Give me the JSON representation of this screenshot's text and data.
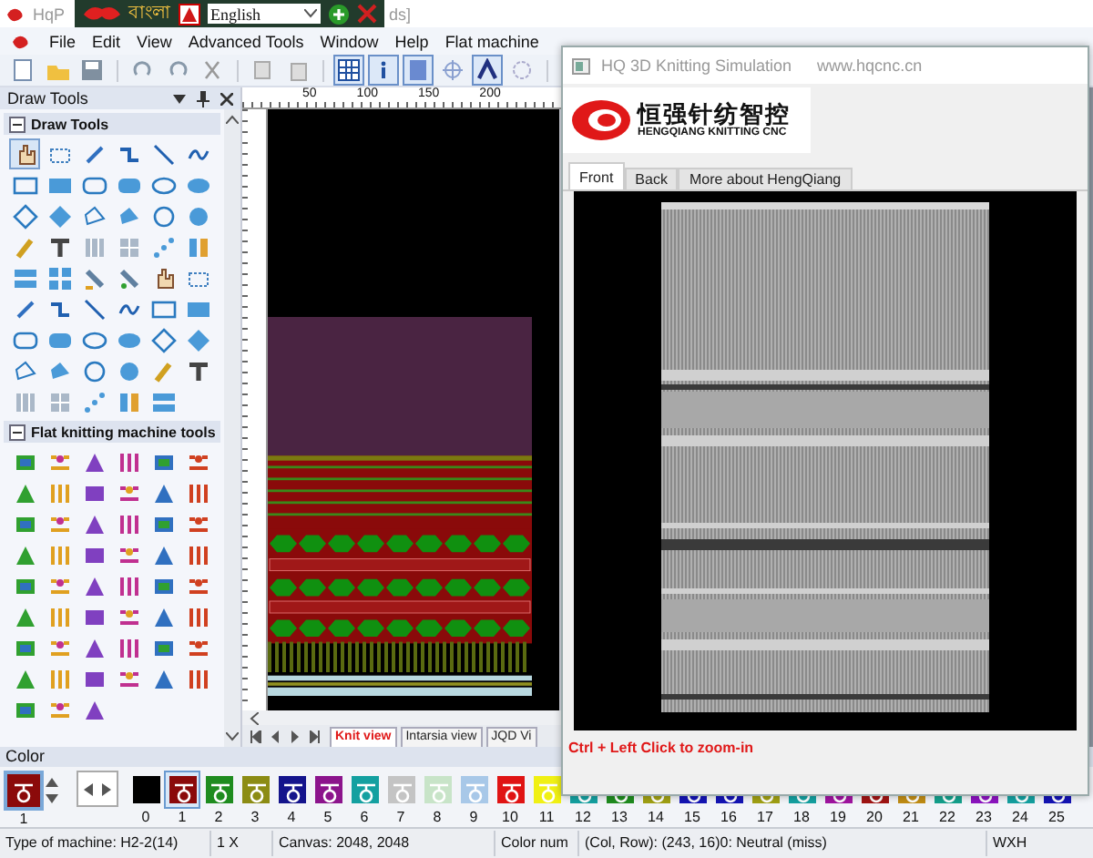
{
  "title_bar": {
    "title_start": "HqP",
    "title_end": "ds]"
  },
  "language_bar": {
    "language_name": "বাংলা",
    "language": "English"
  },
  "menu": [
    "File",
    "Edit",
    "View",
    "Advanced Tools",
    "Window",
    "Help",
    "Flat machine"
  ],
  "left_panel": {
    "title": "Draw Tools",
    "sections": [
      {
        "title": "Draw Tools",
        "tools": [
          {
            "selected": true
          },
          {
            "selected": false
          },
          {
            "selected": false
          },
          {
            "selected": false
          },
          {
            "selected": false
          },
          {
            "selected": false
          },
          {
            "selected": false
          },
          {
            "selected": false
          },
          {
            "selected": false
          },
          {
            "selected": false
          },
          {
            "selected": false
          },
          {
            "selected": false
          },
          {
            "selected": false
          },
          {
            "selected": false
          },
          {
            "selected": false
          },
          {
            "selected": false
          },
          {
            "selected": false
          },
          {
            "selected": false
          },
          {
            "selected": false
          },
          {
            "selected": false
          },
          {
            "selected": false
          },
          {
            "selected": false
          },
          {
            "selected": false
          },
          {
            "selected": false
          },
          {
            "selected": false
          },
          {
            "selected": false
          },
          {
            "selected": false
          },
          {
            "selected": false
          },
          {
            "selected": false
          },
          {
            "selected": false
          },
          {
            "selected": false
          },
          {
            "selected": false
          },
          {
            "selected": false
          },
          {
            "selected": false
          },
          {
            "selected": false
          },
          {
            "selected": false
          },
          {
            "selected": false
          },
          {
            "selected": false
          },
          {
            "selected": false
          },
          {
            "selected": false
          },
          {
            "selected": false
          },
          {
            "selected": false
          },
          {
            "selected": false
          },
          {
            "selected": false
          },
          {
            "selected": false
          },
          {
            "selected": false
          },
          {
            "selected": false
          },
          {
            "selected": false
          },
          {
            "selected": false
          },
          {
            "selected": false
          },
          {
            "selected": false
          },
          {
            "selected": false
          },
          {
            "selected": false
          }
        ]
      },
      {
        "title": "Flat knitting machine tools",
        "tools": [
          {
            "selected": false
          },
          {
            "selected": false
          },
          {
            "selected": false
          },
          {
            "selected": false
          },
          {
            "selected": false
          },
          {
            "selected": false
          },
          {
            "selected": false
          },
          {
            "selected": false
          },
          {
            "selected": false
          },
          {
            "selected": false
          },
          {
            "selected": false
          },
          {
            "selected": false
          },
          {
            "selected": false
          },
          {
            "selected": false
          },
          {
            "selected": false
          },
          {
            "selected": false
          },
          {
            "selected": false
          },
          {
            "selected": false
          },
          {
            "selected": false
          },
          {
            "selected": false
          },
          {
            "selected": false
          },
          {
            "selected": false
          },
          {
            "selected": false
          },
          {
            "selected": false
          },
          {
            "selected": false
          },
          {
            "selected": false
          },
          {
            "selected": false
          },
          {
            "selected": false
          },
          {
            "selected": false
          },
          {
            "selected": false
          },
          {
            "selected": false
          },
          {
            "selected": false
          },
          {
            "selected": false
          },
          {
            "selected": false
          },
          {
            "selected": false
          },
          {
            "selected": false
          },
          {
            "selected": false
          },
          {
            "selected": false
          },
          {
            "selected": false
          },
          {
            "selected": false
          },
          {
            "selected": false
          },
          {
            "selected": false
          },
          {
            "selected": false
          },
          {
            "selected": false
          },
          {
            "selected": false
          },
          {
            "selected": false
          },
          {
            "selected": false
          },
          {
            "selected": false
          },
          {
            "selected": false
          },
          {
            "selected": false
          },
          {
            "selected": false
          }
        ]
      }
    ]
  },
  "ruler": {
    "labels": [
      "50",
      "100",
      "150",
      "200"
    ]
  },
  "view_tabs": [
    {
      "label": "Knit view",
      "selected": true
    },
    {
      "label": "Intarsia view",
      "selected": false
    },
    {
      "label": "JQD Vi",
      "selected": false
    }
  ],
  "simulation": {
    "title": "HQ 3D Knitting Simulation",
    "url": "www.hqcnc.cn",
    "logo_text": "恒强针纺智控",
    "logo_subtitle": "HENGQIANG KNITTING CNC",
    "tabs": [
      {
        "label": "Front",
        "selected": true
      },
      {
        "label": "Back",
        "selected": false
      },
      {
        "label": "More about HengQiang",
        "selected": false
      }
    ],
    "hint": "Ctrl + Left Click to zoom-in"
  },
  "color_bar": {
    "title": "Color",
    "current": {
      "number": "1",
      "color": "#8b0a0a"
    },
    "swatches": [
      {
        "number": "0",
        "color": "#000000",
        "selected": false
      },
      {
        "number": "1",
        "color": "#8b0a0a",
        "selected": true
      },
      {
        "number": "2",
        "color": "#1f8c1f",
        "selected": false
      },
      {
        "number": "3",
        "color": "#8c8c14",
        "selected": false
      },
      {
        "number": "4",
        "color": "#14148c",
        "selected": false
      },
      {
        "number": "5",
        "color": "#8c148c",
        "selected": false
      },
      {
        "number": "6",
        "color": "#14a0a0",
        "selected": false
      },
      {
        "number": "7",
        "color": "#c4c4c4",
        "selected": false
      },
      {
        "number": "8",
        "color": "#c8e4c8",
        "selected": false
      },
      {
        "number": "9",
        "color": "#a8c8e8",
        "selected": false
      },
      {
        "number": "10",
        "color": "#e01414",
        "selected": false
      },
      {
        "number": "11",
        "color": "#f0f014",
        "selected": false
      },
      {
        "number": "12",
        "color": "#14a0a0",
        "selected": false
      },
      {
        "number": "13",
        "color": "#1f8c1f",
        "selected": false
      },
      {
        "number": "14",
        "color": "#a0a014",
        "selected": false
      },
      {
        "number": "15",
        "color": "#1414b4",
        "selected": false
      },
      {
        "number": "16",
        "color": "#1414b4",
        "selected": false
      },
      {
        "number": "17",
        "color": "#a0a014",
        "selected": false
      },
      {
        "number": "18",
        "color": "#14a0a0",
        "selected": false
      },
      {
        "number": "19",
        "color": "#a014a0",
        "selected": false
      },
      {
        "number": "20",
        "color": "#a01414",
        "selected": false
      },
      {
        "number": "21",
        "color": "#c08c14",
        "selected": false
      },
      {
        "number": "22",
        "color": "#14a08c",
        "selected": false
      },
      {
        "number": "23",
        "color": "#8c14c0",
        "selected": false
      },
      {
        "number": "24",
        "color": "#14a0a0",
        "selected": false
      },
      {
        "number": "25",
        "color": "#1414b4",
        "selected": false
      }
    ]
  },
  "status_bar": {
    "machine": "Type of machine: H2-2(14)",
    "zoom": "1 X",
    "canvas": "Canvas: 2048, 2048",
    "color_num": "Color num",
    "position": "(Col, Row): (243, 16)0: Neutral (miss)",
    "size": "WXH"
  }
}
